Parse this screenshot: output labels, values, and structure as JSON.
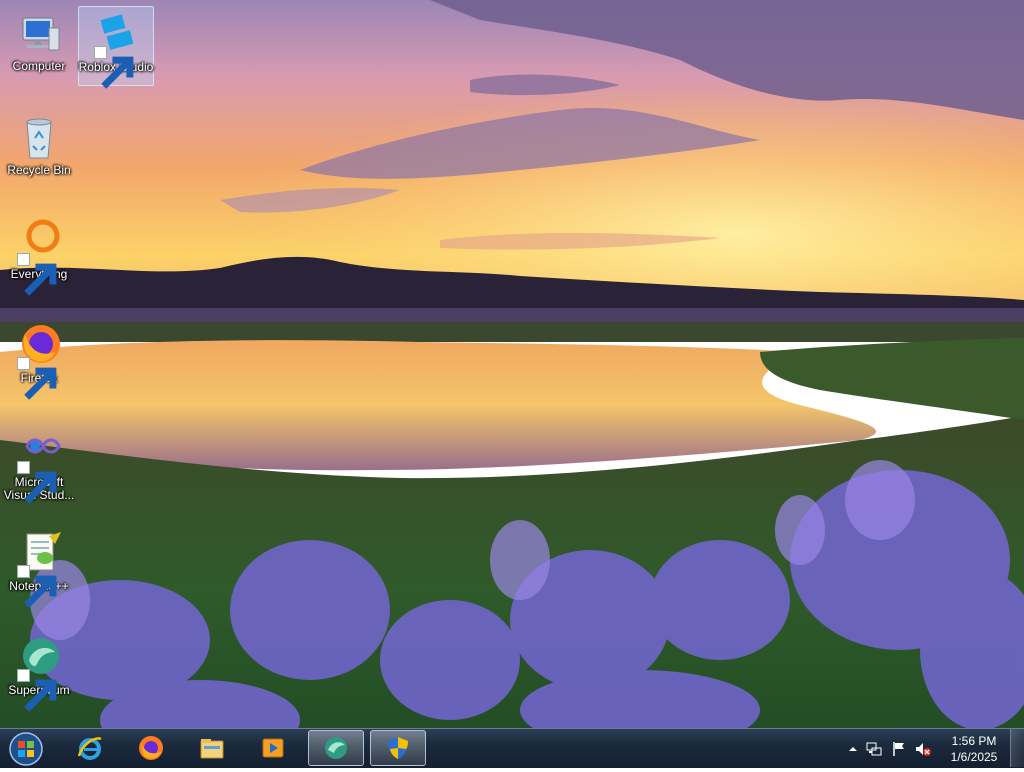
{
  "desktop": {
    "icons": [
      {
        "label": "Computer",
        "icon": "computer-icon"
      },
      {
        "label": "Roblox Studio",
        "icon": "roblox-studio-icon"
      },
      {
        "label": "Recycle Bin",
        "icon": "recycle-bin-icon"
      },
      {
        "label": "Everything",
        "icon": "everything-search-icon"
      },
      {
        "label": "Firefox",
        "icon": "firefox-icon"
      },
      {
        "label": "Microsoft Visual Stud...",
        "icon": "visual-studio-icon"
      },
      {
        "label": "Notepad++",
        "icon": "notepadpp-icon"
      },
      {
        "label": "Supermium",
        "icon": "supermium-icon"
      }
    ]
  },
  "taskbar": {
    "start": "start-orb-icon",
    "pinned": [
      {
        "icon": "internet-explorer-icon"
      },
      {
        "icon": "firefox-icon"
      },
      {
        "icon": "file-explorer-icon"
      },
      {
        "icon": "media-player-icon"
      },
      {
        "icon": "supermium-icon",
        "active": true
      },
      {
        "icon": "uac-shield-icon",
        "active": true
      }
    ]
  },
  "tray": {
    "icons": [
      "show-hidden-icons-chevron",
      "network-icon",
      "action-center-flag-icon",
      "volume-muted-icon"
    ],
    "time": "1:56 PM",
    "date": "1/6/2025"
  },
  "colors": {
    "taskbar": "#1b2a3d",
    "sky_top": "#b58fb4",
    "sunset": "#f5b44a",
    "flowers": "#6f63d0"
  }
}
